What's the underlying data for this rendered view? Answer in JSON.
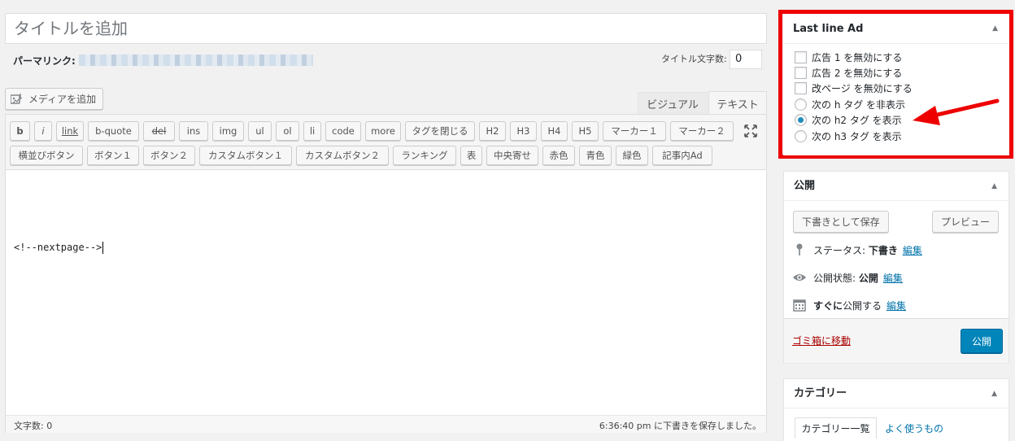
{
  "editor": {
    "title_placeholder": "タイトルを追加",
    "permalink_label": "パーマリンク:",
    "title_char_count_label": "タイトル文字数:",
    "title_char_count": "0",
    "add_media_label": "メディアを追加",
    "tabs": {
      "visual": "ビジュアル",
      "text": "テキスト"
    },
    "quicktags_row1": [
      "b",
      "i",
      "link",
      "b-quote",
      "del",
      "ins",
      "img",
      "ul",
      "ol",
      "li",
      "code",
      "more",
      "タグを閉じる",
      "H2",
      "H3",
      "H4",
      "H5",
      "マーカー１",
      "マーカー２"
    ],
    "quicktags_row2": [
      "横並びボタン",
      "ボタン１",
      "ボタン２",
      "カスタムボタン１",
      "カスタムボタン２",
      "ランキング",
      "表",
      "中央寄せ",
      "赤色",
      "青色",
      "緑色",
      "記事内Ad"
    ],
    "content": "<!--nextpage-->",
    "word_count": "文字数: 0",
    "autosave_message": "6:36:40 pm に下書きを保存しました。"
  },
  "last_line_ad": {
    "title": "Last line Ad",
    "options": [
      {
        "type": "checkbox",
        "label": "広告 1 を無効にする",
        "checked": false
      },
      {
        "type": "checkbox",
        "label": "広告 2 を無効にする",
        "checked": false
      },
      {
        "type": "checkbox",
        "label": "改ページ を無効にする",
        "checked": false
      },
      {
        "type": "radio",
        "label": "次の h タグ を非表示",
        "checked": false
      },
      {
        "type": "radio",
        "label": "次の h2 タグ を表示",
        "checked": true
      },
      {
        "type": "radio",
        "label": "次の h3 タグ を表示",
        "checked": false
      }
    ],
    "highlight_color": "#ee0000"
  },
  "publish": {
    "title": "公開",
    "save_draft_label": "下書きとして保存",
    "preview_label": "プレビュー",
    "status_label": "ステータス:",
    "status_value": "下書き",
    "visibility_label": "公開状態:",
    "visibility_value": "公開",
    "schedule_value": "すぐに",
    "schedule_label": "公開する",
    "edit_label": "編集",
    "trash_label": "ゴミ箱に移動",
    "publish_label": "公開",
    "publish_color": "#0085ba"
  },
  "categories": {
    "title": "カテゴリー",
    "tab_all": "カテゴリー一覧",
    "tab_popular": "よく使うもの"
  }
}
